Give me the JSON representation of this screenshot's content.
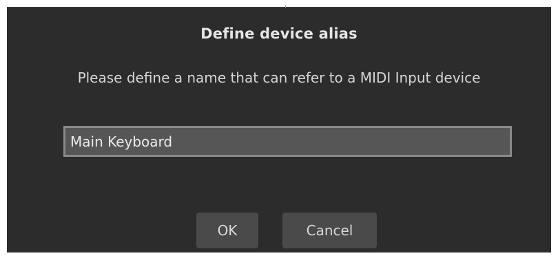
{
  "dialog": {
    "title": "Define device alias",
    "message": "Please define a name that can refer to a MIDI Input device",
    "alias_input": {
      "value": "Main Keyboard",
      "placeholder": ""
    },
    "buttons": {
      "ok_label": "OK",
      "cancel_label": "Cancel"
    }
  },
  "colors": {
    "dialog_background": "#2c2c2c",
    "input_background": "#565656",
    "input_border": "#8a8a8a",
    "button_background": "#4a4a4a",
    "text": "#e6e6e6"
  }
}
